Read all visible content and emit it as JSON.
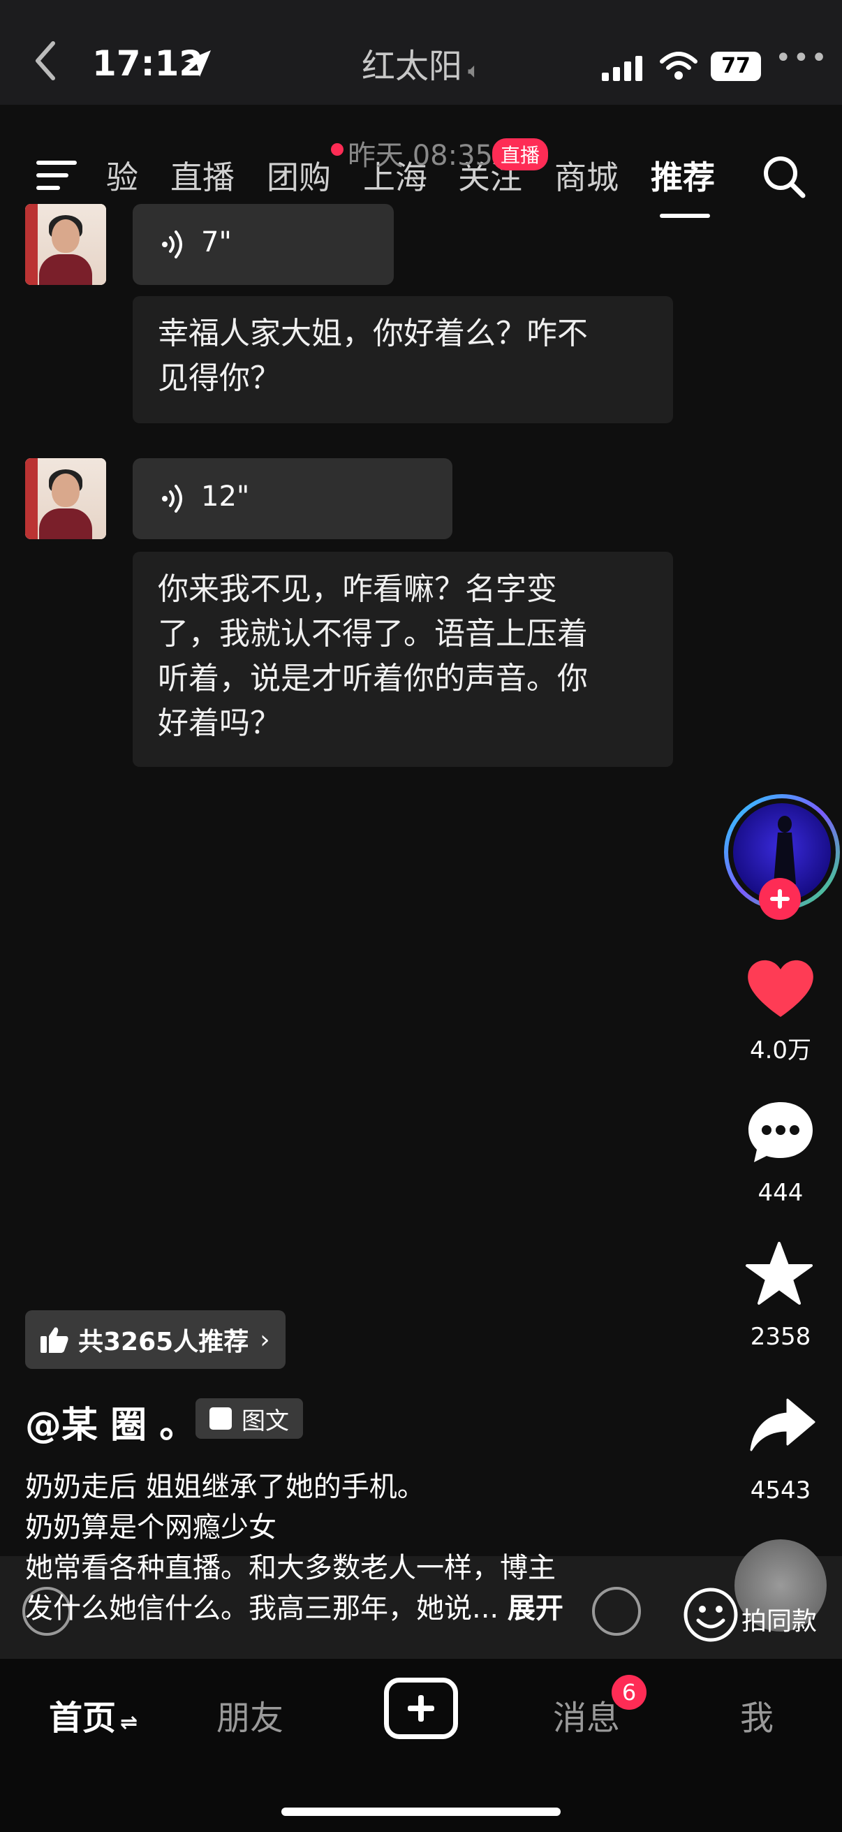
{
  "status_bar": {
    "time": "17:12",
    "center_title": "红太阳",
    "battery": "77"
  },
  "top_nav": {
    "tabs": [
      "验",
      "直播",
      "团购",
      "上海",
      "关注",
      "商城",
      "推荐"
    ],
    "active_tab": "推荐",
    "live_badge": "直播",
    "overlay_timestamp": "昨天 08:35"
  },
  "chat": [
    {
      "voice_duration": "7\"",
      "text": "幸福人家大姐，你好着么？咋不\n见得你？"
    },
    {
      "voice_duration": "12\"",
      "text": "你来我不见，咋看嘛？名字变\n了，我就认不得了。语音上压着\n听着，说是才听着你的声音。你\n好着吗？"
    }
  ],
  "right_rail": {
    "like_count": "4.0万",
    "comment_count": "444",
    "favorite_count": "2358",
    "share_count": "4543"
  },
  "post": {
    "recommend_label": "共3265人推荐",
    "author": "@某 圈 。",
    "type_label": "图文",
    "description_lines": [
      "奶奶走后 姐姐继承了她的手机。",
      "奶奶算是个网瘾少女",
      "她常看各种直播。和大多数老人一样，博主",
      "发什么她信什么。我高三那年，她说..."
    ],
    "expand_label": "展开",
    "same_style_label": "拍同款"
  },
  "bottom_nav": {
    "items": [
      "首页",
      "朋友",
      "消息",
      "我"
    ],
    "home_suffix": "⇌",
    "message_badge": "6"
  },
  "colors": {
    "accent": "#fe2c55",
    "background": "#0f0f0f"
  }
}
